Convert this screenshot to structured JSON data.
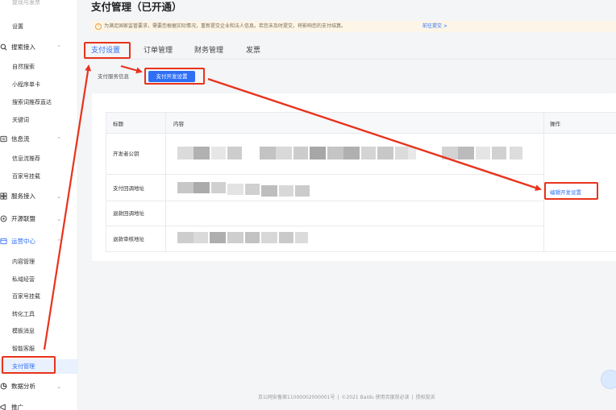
{
  "sidebar": {
    "top_partial": "提现与发票",
    "settings": "设置",
    "groups": [
      {
        "label": "搜索接入",
        "icon": "search-icon",
        "children": [
          "自然搜索",
          "小程序单卡",
          "搜索词推荐直达",
          "关键词"
        ]
      },
      {
        "label": "信息流",
        "icon": "feed-icon",
        "children": [
          "信息流推荐",
          "百家号挂载"
        ]
      },
      {
        "label": "服务接入",
        "icon": "service-icon",
        "children": []
      },
      {
        "label": "开源联盟",
        "icon": "alliance-icon",
        "children": []
      },
      {
        "label": "运营中心",
        "icon": "operation-icon",
        "children": [
          "内容管理",
          "私域经营",
          "百家号挂载",
          "转化工具",
          "模板消息",
          "智能客服",
          "支付管理"
        ]
      },
      {
        "label": "数据分析",
        "icon": "chart-icon",
        "children": []
      },
      {
        "label": "推广",
        "icon": "promo-icon",
        "children": []
      }
    ]
  },
  "header": {
    "title": "支付管理（已开通）"
  },
  "notice": {
    "text": "为满足国家监管要求，需要您根据实际情况，重新提交企业和法人信息。若您未及时提交，将影响您的支付结算。",
    "link": "前往提交 >"
  },
  "tabs": [
    "支付设置",
    "订单管理",
    "财务管理",
    "发票"
  ],
  "subtabs": {
    "info": "支付服务信息",
    "dev_settings": "支付开发设置"
  },
  "table": {
    "headers": {
      "title": "标题",
      "content": "内容",
      "action": "操作"
    },
    "rows": [
      "开发者公钥",
      "支付回调地址",
      "退款回调地址",
      "退款审核地址"
    ],
    "action_link": "编辑开发设置"
  },
  "footer": {
    "icp": "京公网安备案11000002000001号",
    "copyright": "©2021 Baidu 使用百度前必读",
    "license": "授权投诉"
  },
  "colors": {
    "accent": "#2f6ff5",
    "annotation": "#e8331c",
    "notice_bg": "#fdf6e8"
  }
}
